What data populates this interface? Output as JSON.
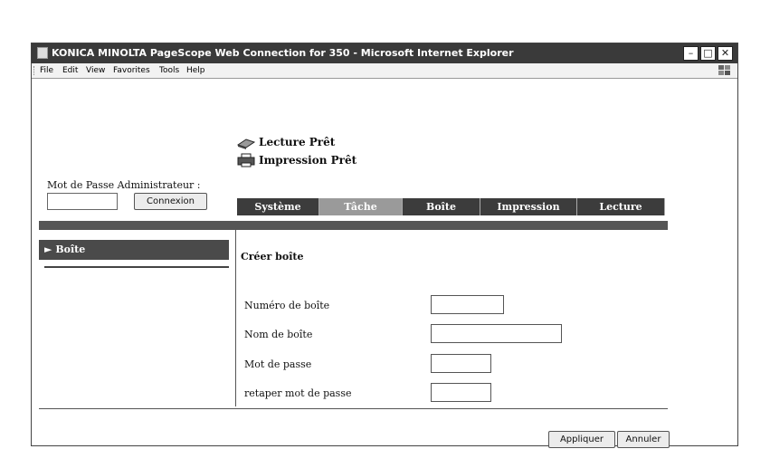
{
  "window": {
    "title": "KONICA MINOLTA PageScope Web Connection for 350 - Microsoft Internet Explorer"
  },
  "menu": [
    "File",
    "Edit",
    "View",
    "Favorites",
    "Tools",
    "Help"
  ],
  "status": {
    "scan": "Lecture Prêt",
    "print": "Impression Prêt"
  },
  "admin": {
    "label": "Mot de Passe Administrateur :",
    "password_value": "",
    "login_button": "Connexion"
  },
  "tabs": [
    {
      "label": "Système",
      "active": false
    },
    {
      "label": "Tâche",
      "active": true
    },
    {
      "label": "Boîte",
      "active": false
    },
    {
      "label": "Impression",
      "active": false
    },
    {
      "label": "Lecture",
      "active": false
    }
  ],
  "sidebar": {
    "items": [
      {
        "label": "Boîte"
      }
    ]
  },
  "form": {
    "title": "Créer boîte",
    "fields": [
      {
        "label": "Numéro de boîte",
        "value": ""
      },
      {
        "label": "Nom de boîte",
        "value": ""
      },
      {
        "label": "Mot de passe",
        "value": ""
      },
      {
        "label": "retaper mot de passe",
        "value": ""
      }
    ],
    "apply_button": "Appliquer",
    "cancel_button": "Annuler"
  },
  "colors": {
    "titlebar": "#3a3a3a",
    "tab_dark": "#3c3c3c",
    "tab_light": "#9a9a9a",
    "sidebar_item": "#4a4a4a"
  }
}
